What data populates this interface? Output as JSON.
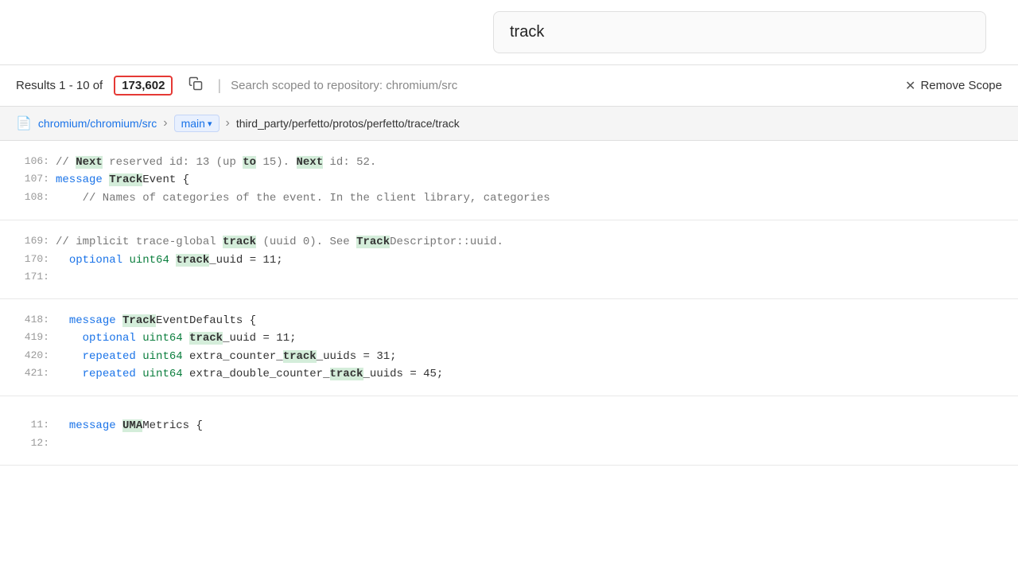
{
  "search": {
    "query": "track",
    "placeholder": "track"
  },
  "results_header": {
    "prefix": "Results 1 - 10 of",
    "count": "173,602",
    "scope_text": "Search scoped to repository: chromium/src",
    "remove_label": "Remove Scope"
  },
  "breadcrumb": {
    "repo": "chromium/chromium/src",
    "branch": "main",
    "path": "third_party/perfetto/protos/perfetto/trace/track"
  },
  "result_block_1": {
    "lines": [
      {
        "num": "106:",
        "text": "// Next reserved id: 13 (up to 15). Next id: 52."
      },
      {
        "num": "107:",
        "text": "message TrackEvent {"
      },
      {
        "num": "108:",
        "text": "    // Names of categories of the event. In the client library, categories"
      }
    ]
  },
  "result_block_2": {
    "lines": [
      {
        "num": "169:",
        "text": "// implicit trace-global track (uuid 0). See TrackDescriptor::uuid."
      },
      {
        "num": "170:",
        "text": "  optional uint64 track_uuid = 11;"
      },
      {
        "num": "171:",
        "text": ""
      }
    ]
  },
  "result_block_3": {
    "lines": [
      {
        "num": "418:",
        "text": "  message TrackEventDefaults {"
      },
      {
        "num": "419:",
        "text": "    optional uint64 track_uuid = 11;"
      },
      {
        "num": "420:",
        "text": "    repeated uint64 extra_counter_track_uuids = 31;"
      },
      {
        "num": "421:",
        "text": "    repeated uint64 extra_double_counter_track_uuids = 45;"
      }
    ]
  },
  "result_block_4": {
    "lines": [
      {
        "num": "11:",
        "text": "  message UMAMetrics {"
      },
      {
        "num": "12:",
        "text": ""
      }
    ]
  }
}
